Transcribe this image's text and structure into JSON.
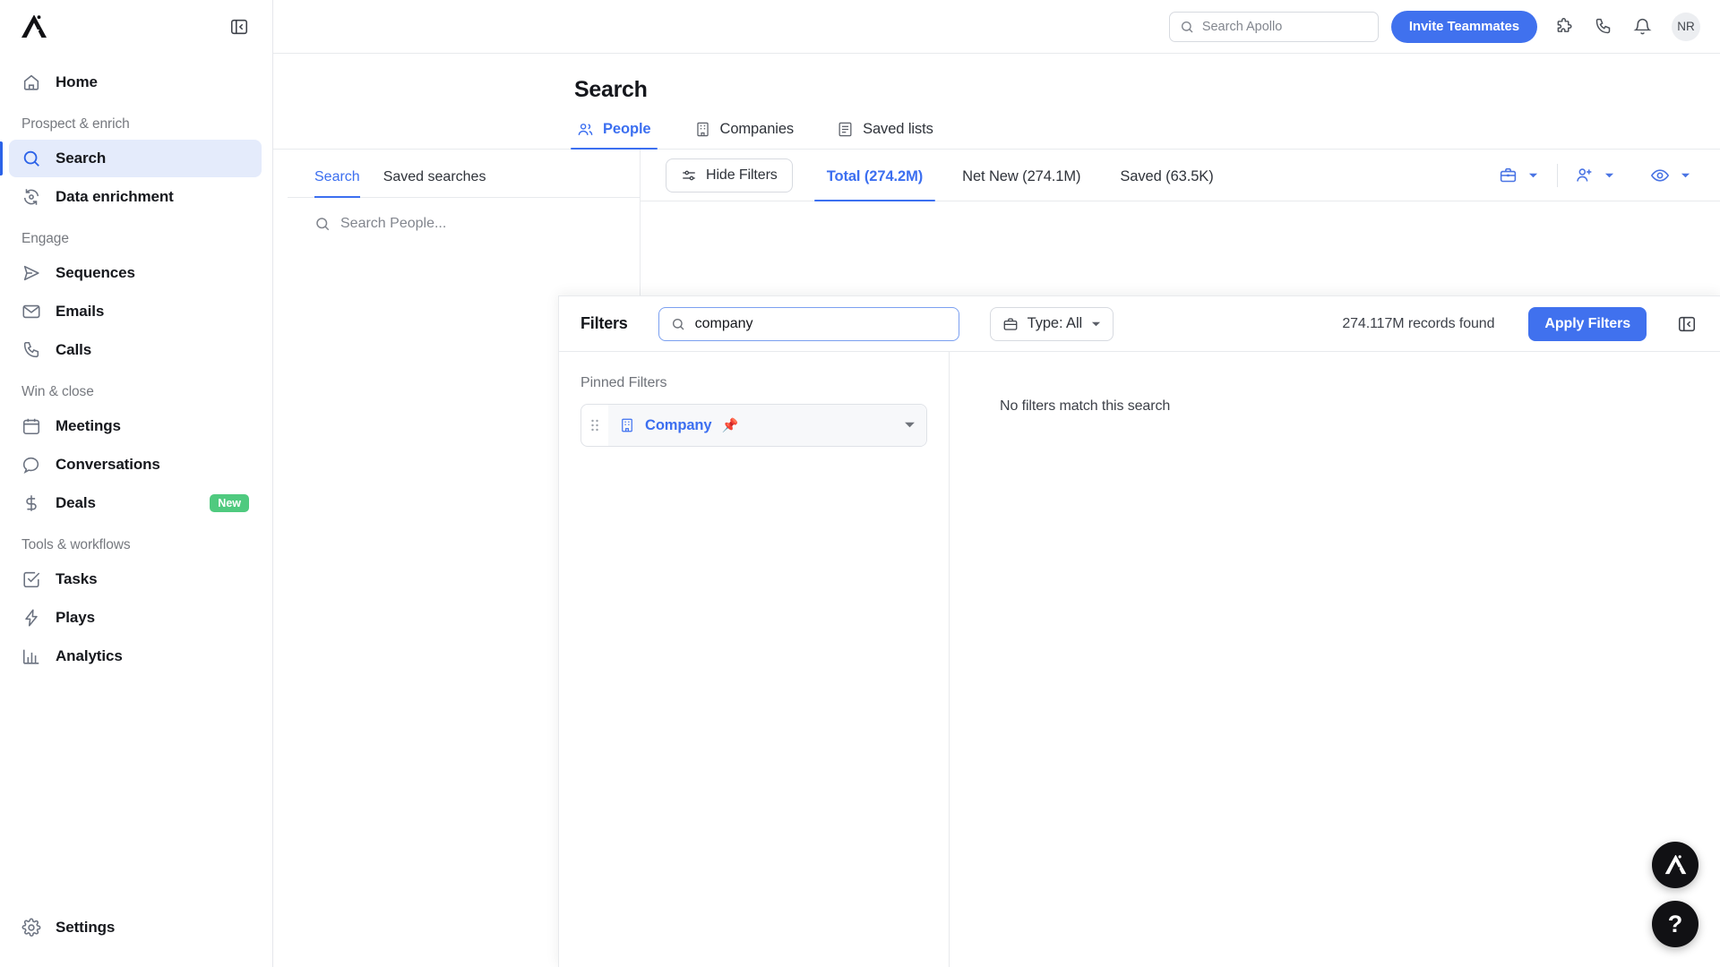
{
  "sidebar": {
    "logo_alt": "Apollo",
    "collapse_icon": "panel-collapse-icon",
    "home": {
      "label": "Home",
      "icon": "home-icon"
    },
    "groups": [
      {
        "label": "Prospect & enrich",
        "items": [
          {
            "label": "Search",
            "icon": "search-icon",
            "active": true
          },
          {
            "label": "Data enrichment",
            "icon": "refresh-data-icon",
            "active": false
          }
        ]
      },
      {
        "label": "Engage",
        "items": [
          {
            "label": "Sequences",
            "icon": "send-icon",
            "active": false
          },
          {
            "label": "Emails",
            "icon": "envelope-icon",
            "active": false
          },
          {
            "label": "Calls",
            "icon": "phone-icon",
            "active": false
          }
        ]
      },
      {
        "label": "Win & close",
        "items": [
          {
            "label": "Meetings",
            "icon": "calendar-icon",
            "active": false
          },
          {
            "label": "Conversations",
            "icon": "chat-bubble-icon",
            "active": false
          },
          {
            "label": "Deals",
            "icon": "dollar-icon",
            "active": false,
            "badge": "New"
          }
        ]
      },
      {
        "label": "Tools & workflows",
        "items": [
          {
            "label": "Tasks",
            "icon": "check-square-icon",
            "active": false
          },
          {
            "label": "Plays",
            "icon": "lightning-icon",
            "active": false
          },
          {
            "label": "Analytics",
            "icon": "bar-chart-icon",
            "active": false
          }
        ]
      }
    ],
    "settings": {
      "label": "Settings",
      "icon": "gear-icon"
    }
  },
  "topbar": {
    "search_placeholder": "Search Apollo",
    "invite_label": "Invite Teammates",
    "icons": [
      "puzzle-icon",
      "phone-icon",
      "bell-icon"
    ],
    "avatar_initials": "NR"
  },
  "page": {
    "title": "Search",
    "tabs": [
      {
        "label": "People",
        "icon": "people-icon",
        "active": true
      },
      {
        "label": "Companies",
        "icon": "building-icon",
        "active": false
      },
      {
        "label": "Saved lists",
        "icon": "list-icon",
        "active": false
      }
    ]
  },
  "search_panel": {
    "tabs": [
      {
        "label": "Search",
        "active": true
      },
      {
        "label": "Saved searches",
        "active": false
      }
    ],
    "input_placeholder": "Search People..."
  },
  "toolbar": {
    "hide_filters_label": "Hide Filters",
    "stat_tabs": [
      {
        "label": "Total (274.2M)",
        "active": true
      },
      {
        "label": "Net New (274.1M)",
        "active": false
      },
      {
        "label": "Saved (63.5K)",
        "active": false
      }
    ],
    "actions": [
      "briefcase-icon",
      "add-person-icon",
      "eye-icon"
    ]
  },
  "filters": {
    "title": "Filters",
    "search_value": "company",
    "type_label": "Type: All",
    "records_found": "274.117M records found",
    "apply_label": "Apply Filters",
    "collapse_icon": "panel-collapse-icon",
    "pinned_label": "Pinned Filters",
    "pinned_items": [
      {
        "label": "Company",
        "icon": "building-icon",
        "pin_emoji": "📌"
      }
    ],
    "empty_message": "No filters match this search"
  },
  "fabs": [
    {
      "name": "apollo-assistant",
      "glyph": "logo"
    },
    {
      "name": "help",
      "glyph": "?"
    }
  ],
  "colors": {
    "accent_blue": "#4071ee",
    "link_blue": "#3c6ff0",
    "badge_green": "#4fca7f",
    "active_nav_bg": "#e4ebfb"
  }
}
